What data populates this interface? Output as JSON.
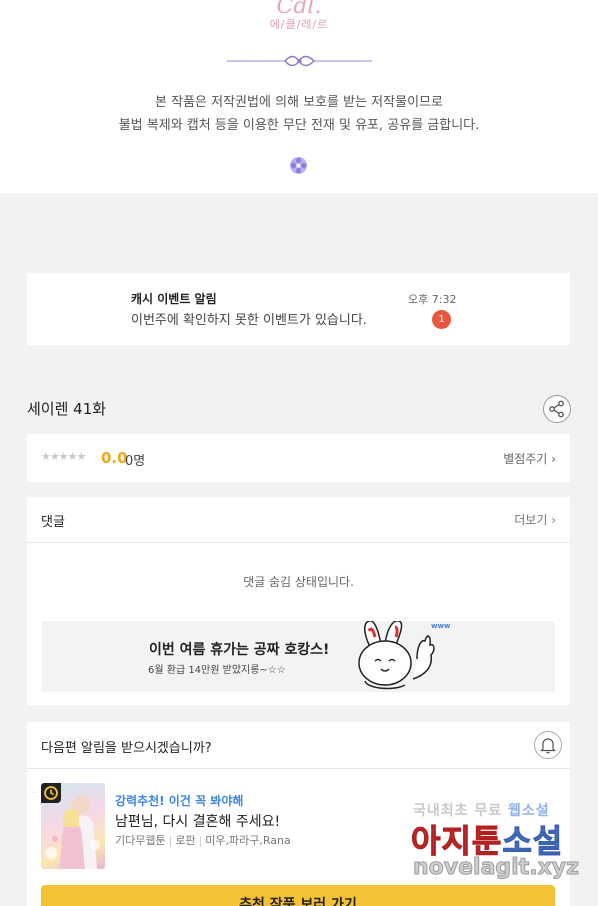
{
  "copyright": {
    "logo_text": "Cdl.",
    "logo_sub": "에/클/레/르",
    "line1": "본 작품은 저작권법에 의해 보호를 받는 저작물이므로",
    "line2": "불법 복제와 캡처 등을 이용한 무단 전재 및 유포, 공유를 금합니다."
  },
  "notification": {
    "title": "캐시 이벤트 알림",
    "message": "이번주에 확인하지 못한 이벤트가 있습니다.",
    "time": "오후 7:32",
    "badge_count": "1"
  },
  "episode": {
    "title": "세이렌 41화",
    "share_icon": "share-icon"
  },
  "rating": {
    "stars": "★★★★★",
    "score": "0.0",
    "count": "0명",
    "rate_label": "별점주기",
    "rate_chevron": "›"
  },
  "comments": {
    "header": "댓글",
    "more_label": "더보기",
    "more_chevron": "›",
    "hidden_message": "댓글 숨김 상태입니다."
  },
  "banner": {
    "title": "이번 여름 휴가는 공짜 호캉스!",
    "subtitle": "6월 환급 14만원 받았지롱~☆☆",
    "mascot_tag": "www"
  },
  "next_alert": {
    "question": "다음편 알림을 받으시겠습니까?",
    "bell_icon": "bell-icon"
  },
  "recommendation": {
    "tag": "강력추천! 이건 꼭 봐야해",
    "title": "남편님, 다시 결혼해 주세요!",
    "meta": [
      "기다무웹툰",
      "로판",
      "미우,파라구,Rana"
    ],
    "button_label": "추천 작품 보러 가기"
  },
  "watermark": {
    "line1_a": "국내최초 무료 ",
    "line1_b": "웹소설",
    "line2_a": "아지툰",
    "line2_b": "소설",
    "line3": "novelagit.xyz"
  },
  "colors": {
    "accent_yellow": "#f5c236",
    "badge_red": "#e8563f",
    "score_orange": "#f0a818",
    "tag_blue": "#3b86e8"
  }
}
